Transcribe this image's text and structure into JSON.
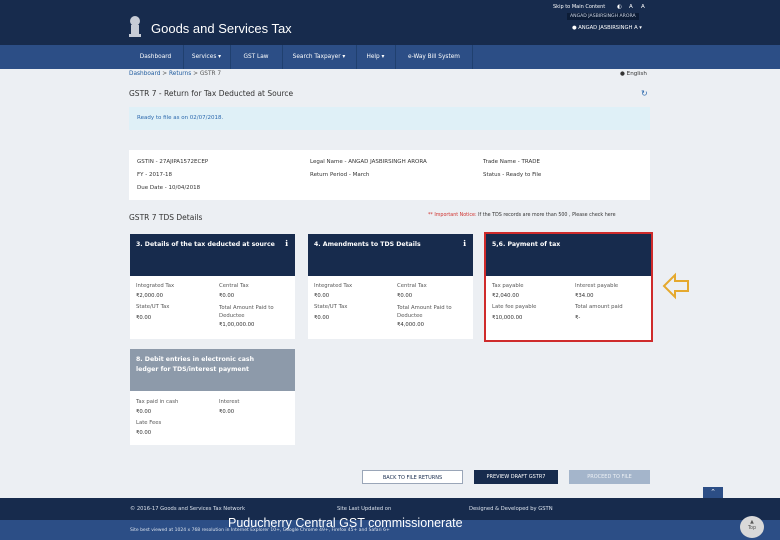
{
  "header": {
    "title": "Goods and Services Tax",
    "skip_link": "Skip to Main Content",
    "font_sizes": [
      "A",
      "A"
    ],
    "user_badge": "ANGAD JASBIRSINGH ARORA",
    "user_menu": "ANGAD JASBIRSINGH A"
  },
  "nav": {
    "items": [
      "Dashboard",
      "Services",
      "GST Law",
      "Search Taxpayer",
      "Help",
      "e-Way Bill System"
    ]
  },
  "breadcrumb": {
    "dashboard": "Dashboard",
    "returns": "Returns",
    "current": "GSTR 7"
  },
  "language": "English",
  "page_title": "GSTR 7 - Return for Tax Deducted at Source",
  "ready_msg": "Ready to file as on 02/07/2018.",
  "info": {
    "gstin": "GSTIN - 27AJIPA1572ECEP",
    "fy": "FY - 2017-18",
    "due": "Due Date - 10/04/2018",
    "legal": "Legal Name - ANGAD JASBIRSINGH ARORA",
    "period": "Return Period - March",
    "trade": "Trade Name - TRADE",
    "status": "Status - Ready to File"
  },
  "section_title": "GSTR 7 TDS Details",
  "notice": {
    "mark": "**",
    "label": "Important Notice:",
    "text": "If the TDS records are more than 500 , Please check here"
  },
  "cards": [
    {
      "title": "3. Details of the tax deducted at source",
      "labels": [
        "Integrated Tax",
        "Central Tax",
        "State/UT Tax",
        "Total Amount Paid to Deductee"
      ],
      "values": [
        "₹2,000.00",
        "₹0.00",
        "₹0.00",
        "₹1,00,000.00"
      ]
    },
    {
      "title": "4. Amendments to TDS Details",
      "labels": [
        "Integrated Tax",
        "Central Tax",
        "State/UT Tax",
        "Total Amount Paid to Deductee"
      ],
      "values": [
        "₹0.00",
        "₹0.00",
        "₹0.00",
        "₹4,000.00"
      ]
    },
    {
      "title": "5,6. Payment of tax",
      "labels": [
        "Tax payable",
        "Interest payable",
        "Late fee payable",
        "Total amount paid"
      ],
      "values": [
        "₹2,040.00",
        "₹34.00",
        "₹10,000.00",
        "₹-"
      ]
    },
    {
      "title": "8. Debit entries in electronic cash ledger for TDS/interest payment",
      "labels": [
        "Tax paid in cash",
        "Interest",
        "Late Fees"
      ],
      "values": [
        "₹0.00",
        "₹0.00",
        "₹0.00"
      ]
    }
  ],
  "buttons": {
    "back": "BACK TO FILE RETURNS",
    "preview": "PREVIEW DRAFT GSTR7",
    "proceed": "PROCEED TO FILE"
  },
  "footer": {
    "copyright": "© 2016-17 Goods and Services Tax Network",
    "updated": "Site Last Updated on",
    "designed": "Designed & Developed by GSTN",
    "best": "Site best viewed at 1024 x 768 resolution in Internet Explorer 10+, Google Chrome 49+, Firefox 45+ and Safari 6+",
    "watermark": "Puducherry Central GST commissionerate",
    "top": "Top"
  },
  "colors": {
    "header": "#172b4d",
    "nav": "#2c4e86",
    "highlight": "#cf2b2b",
    "arrow": "#e5a92e"
  }
}
